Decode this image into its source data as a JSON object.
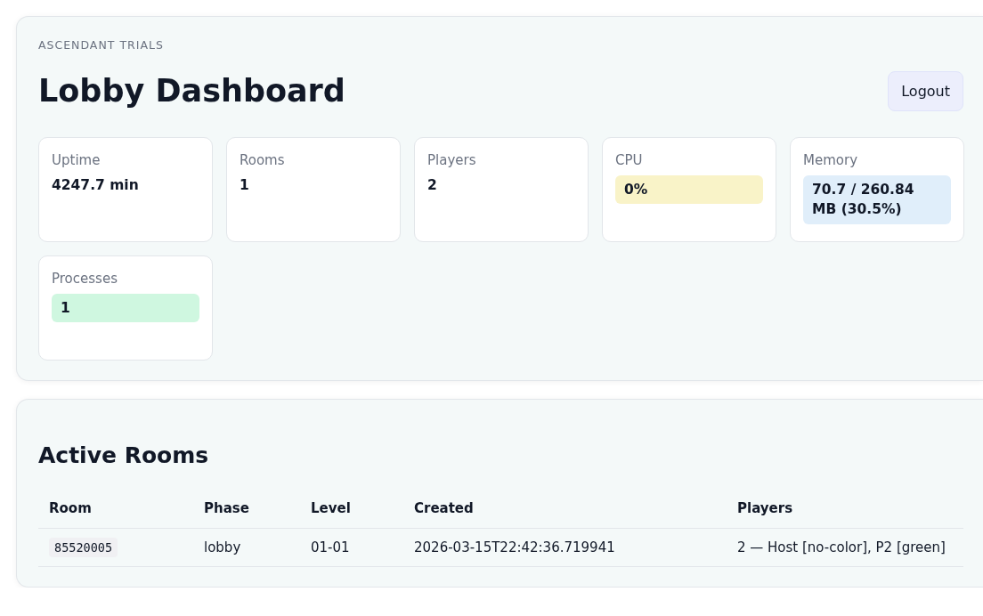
{
  "header": {
    "eyebrow": "ASCENDANT TRIALS",
    "title": "Lobby Dashboard",
    "logout_button": "Logout"
  },
  "stats": [
    {
      "label": "Uptime",
      "value": "4247.7 min",
      "kind": "plain"
    },
    {
      "label": "Rooms",
      "value": "1",
      "kind": "plain"
    },
    {
      "label": "Players",
      "value": "2",
      "kind": "plain"
    },
    {
      "label": "CPU",
      "value": "0%",
      "kind": "highlight",
      "color": "#f9f3c8"
    },
    {
      "label": "Memory",
      "value": "70.7 / 260.84 MB (30.5%)",
      "kind": "highlight",
      "color": "#e0eefa"
    },
    {
      "label": "Processes",
      "value": "1",
      "kind": "highlight",
      "color": "#cff7e0"
    }
  ],
  "rooms": {
    "title": "Active Rooms",
    "columns": [
      "Room",
      "Phase",
      "Level",
      "Created",
      "Players"
    ],
    "rows": [
      {
        "room": "85520005",
        "phase": "lobby",
        "level": "01-01",
        "created": "2026-03-15T22:42:36.719941",
        "players": "2 — Host [no-color], P2 [green]"
      }
    ]
  }
}
